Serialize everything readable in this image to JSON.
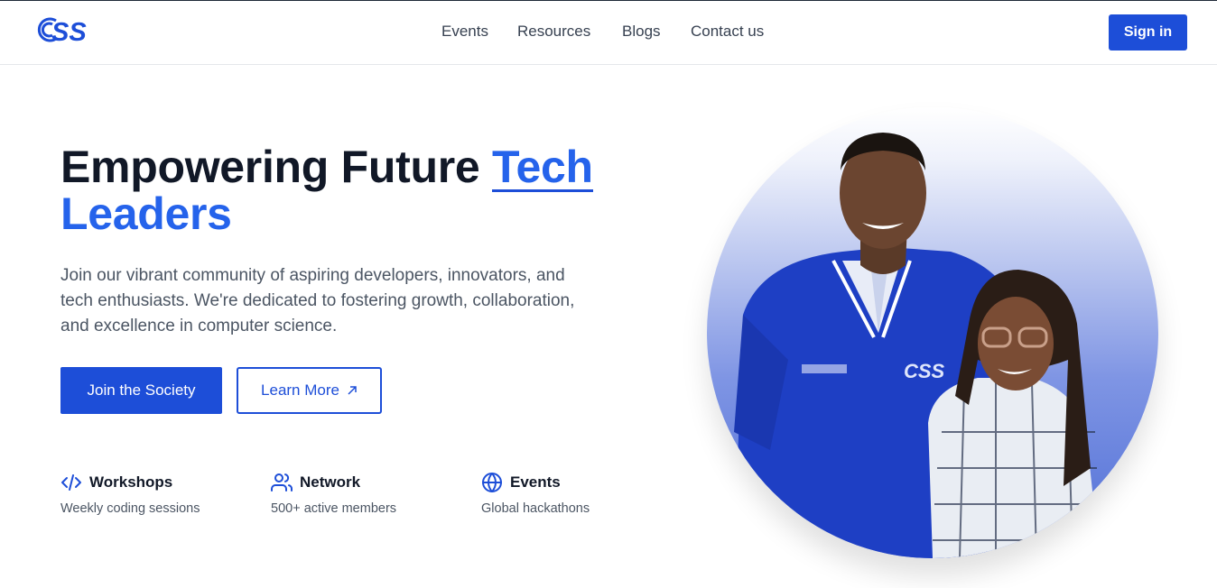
{
  "header": {
    "logo_text": "CSS",
    "nav": [
      "Events",
      "Resources",
      "Blogs",
      "Contact us"
    ],
    "signin_label": "Sign in"
  },
  "hero": {
    "title_part1": "Empowering Future ",
    "title_accent1": "Tech",
    "title_accent2": "Leaders",
    "description": "Join our vibrant community of aspiring developers, innovators, and tech enthusiasts. We're dedicated to fostering growth, collaboration, and excellence in computer science.",
    "join_label": "Join the Society",
    "more_label": "Learn More"
  },
  "features": [
    {
      "icon": "code-icon",
      "title": "Workshops",
      "desc": "Weekly coding sessions"
    },
    {
      "icon": "users-icon",
      "title": "Network",
      "desc": "500+ active members"
    },
    {
      "icon": "globe-icon",
      "title": "Events",
      "desc": "Global hackathons"
    }
  ],
  "colors": {
    "brand": "#1d4ed8",
    "accent": "#2563eb",
    "text": "#111827",
    "muted": "#4b5563"
  }
}
